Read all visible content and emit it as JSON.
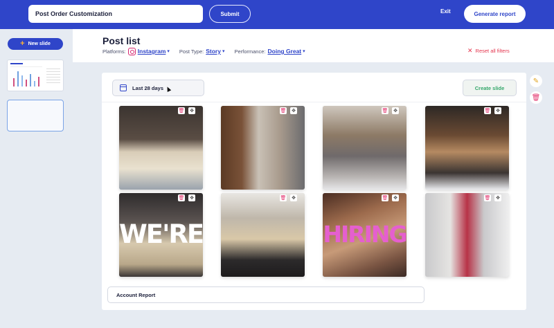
{
  "topbar": {
    "title_value": "Post Order Customization",
    "submit_label": "Submit",
    "exit_label": "Exit",
    "generate_label": "Generate report"
  },
  "sidebar": {
    "new_slide_label": "New slide"
  },
  "header": {
    "title": "Post list",
    "platforms_label": "Platforms:",
    "platform_value": "Instagram",
    "post_type_label": "Post Type:",
    "post_type_value": "Story",
    "performance_label": "Performance:",
    "performance_value": "Doing Great",
    "reset_label": "Reset all filters"
  },
  "main": {
    "date_label": "Last 28 days",
    "create_slide_label": "Create slide",
    "account_label": "Account Report",
    "posts": [
      {
        "overlay": ""
      },
      {
        "overlay": ""
      },
      {
        "overlay": ""
      },
      {
        "overlay": ""
      },
      {
        "overlay": "WE'RE"
      },
      {
        "overlay": ""
      },
      {
        "overlay": "HIRING"
      },
      {
        "overlay": ""
      }
    ]
  },
  "colors": {
    "brand_blue": "#2f45c9",
    "accent_green": "#34a76a",
    "danger_red": "#e4354e",
    "pink": "#e2336d",
    "new_slide_plus": "#ffb432"
  },
  "icons": {
    "instagram": "instagram-icon",
    "calendar": "calendar-icon",
    "trash": "trash-icon",
    "move": "move-icon",
    "edit": "edit-icon",
    "close": "close-icon"
  }
}
